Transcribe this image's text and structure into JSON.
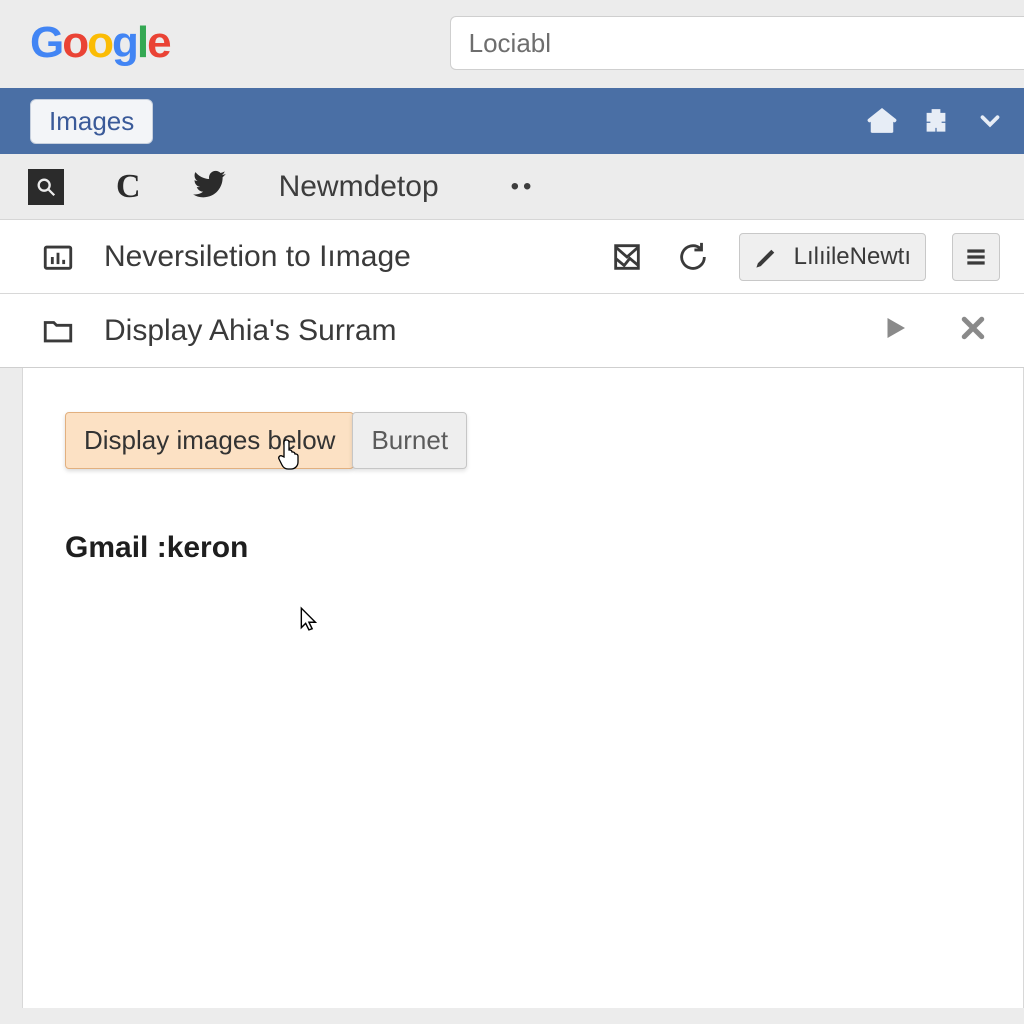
{
  "header": {
    "search_value": "Lociabl"
  },
  "bluebar": {
    "images_label": "Images"
  },
  "toolstrip": {
    "label": "Newmdetop"
  },
  "row1": {
    "title": "Neversiletion to Iımage",
    "edit_label": "LılıileNewtı"
  },
  "row2": {
    "title": "Display Ahia's Surram"
  },
  "content": {
    "display_btn": "Display images below",
    "burnet_btn": "Burnet",
    "heading": "Gmail :keron"
  }
}
